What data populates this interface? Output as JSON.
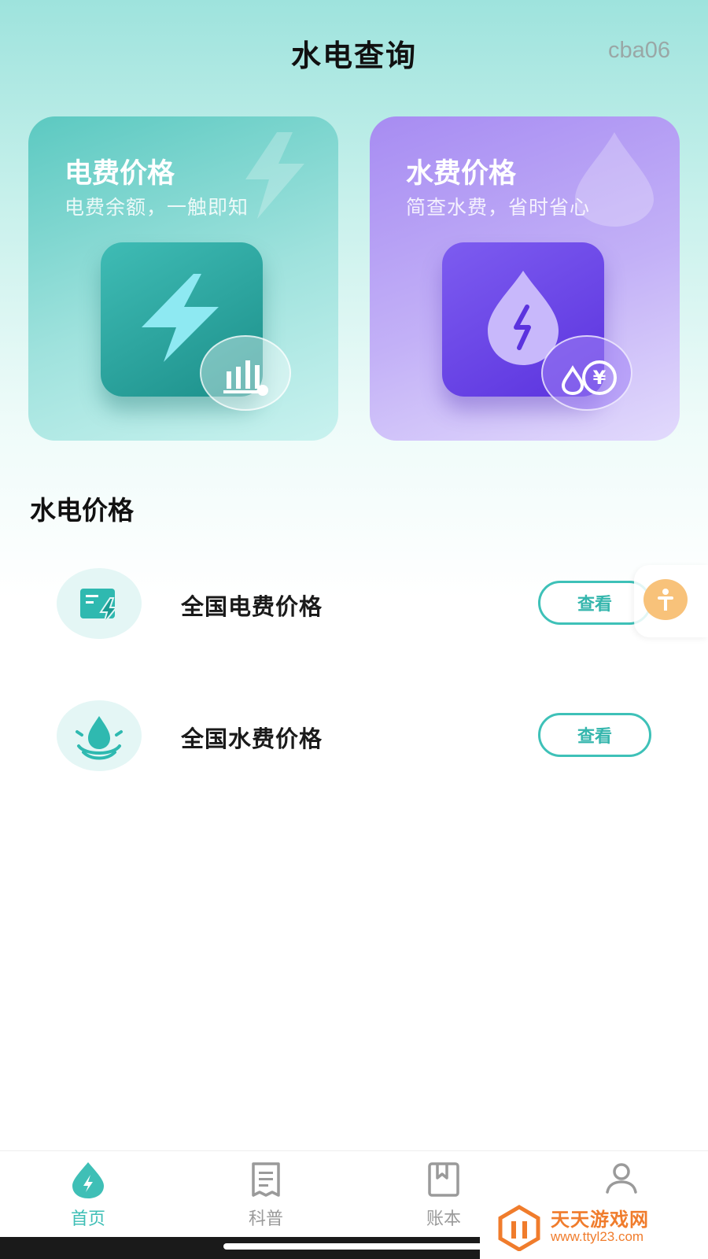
{
  "header": {
    "title": "水电查询",
    "user_id": "cba06"
  },
  "cards": [
    {
      "id": "electricity",
      "title": "电费价格",
      "subtitle": "电费余额，一触即知",
      "icon": "lightning-icon",
      "badge_icon": "bar-chart-icon"
    },
    {
      "id": "water",
      "title": "水费价格",
      "subtitle": "简查水费，省时省心",
      "icon": "water-drop-lightning-icon",
      "badge_icon": "yen-drop-icon"
    }
  ],
  "section": {
    "title": "水电价格"
  },
  "price_rows": [
    {
      "label": "全国电费价格",
      "button": "查看",
      "icon": "electric-bill-icon"
    },
    {
      "label": "全国水费价格",
      "button": "查看",
      "icon": "water-ripple-icon"
    }
  ],
  "tabs": [
    {
      "label": "首页",
      "icon": "home-drop-icon",
      "active": true
    },
    {
      "label": "科普",
      "icon": "document-icon",
      "active": false
    },
    {
      "label": "账本",
      "icon": "bookmark-book-icon",
      "active": false
    },
    {
      "label": "",
      "icon": "user-icon",
      "active": false
    }
  ],
  "watermark": {
    "title": "天天游戏网",
    "url": "www.ttyl23.com"
  },
  "colors": {
    "accent": "#3fbfb6",
    "electric_card": "#5cc9c1",
    "water_card": "#a78cf2",
    "float_button": "#f8c27a"
  }
}
